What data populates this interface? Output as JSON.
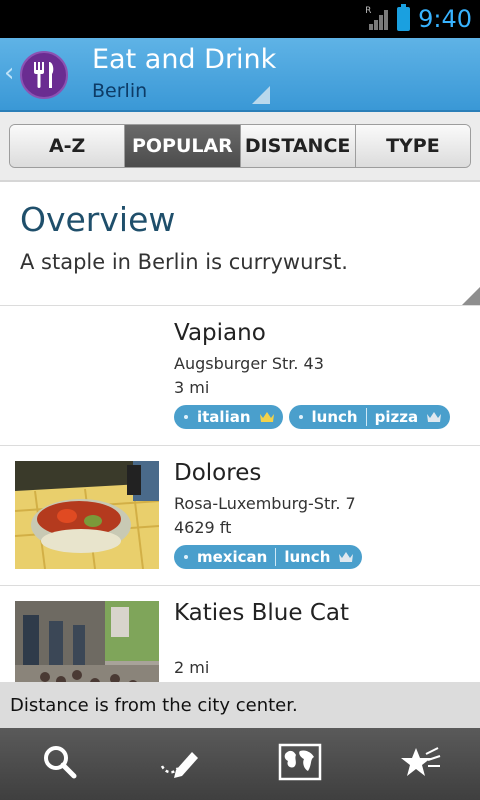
{
  "status_bar": {
    "time": "9:40",
    "signal_label": "R"
  },
  "header": {
    "icon": "fork-knife-icon",
    "title": "Eat and Drink",
    "subtitle": "Berlin",
    "colors": {
      "bar": "#4aa6de",
      "icon_bg": "#6a2c91"
    }
  },
  "tabs": [
    {
      "label": "A-Z",
      "active": false
    },
    {
      "label": "POPULAR",
      "active": true
    },
    {
      "label": "DISTANCE",
      "active": false
    },
    {
      "label": "TYPE",
      "active": false
    }
  ],
  "overview": {
    "title": "Overview",
    "text": "A staple in Berlin is currywurst."
  },
  "listings": [
    {
      "name": "Vapiano",
      "address": "Augsburger Str. 43",
      "distance": "3 mi",
      "has_photo": false,
      "tag_groups": [
        [
          "italian"
        ],
        [
          "lunch",
          "pizza"
        ]
      ]
    },
    {
      "name": "Dolores",
      "address": "Rosa-Luxemburg-Str. 7",
      "distance": "4629 ft",
      "has_photo": true,
      "tag_groups": [
        [
          "mexican",
          "lunch"
        ]
      ]
    },
    {
      "name": "Katies Blue Cat",
      "address": "",
      "distance": "2 mi",
      "has_photo": true,
      "tag_groups": []
    }
  ],
  "note": "Distance is from the city center.",
  "bottom_nav": [
    "search-icon",
    "draw-route-icon",
    "map-icon",
    "favorites-star-icon"
  ]
}
